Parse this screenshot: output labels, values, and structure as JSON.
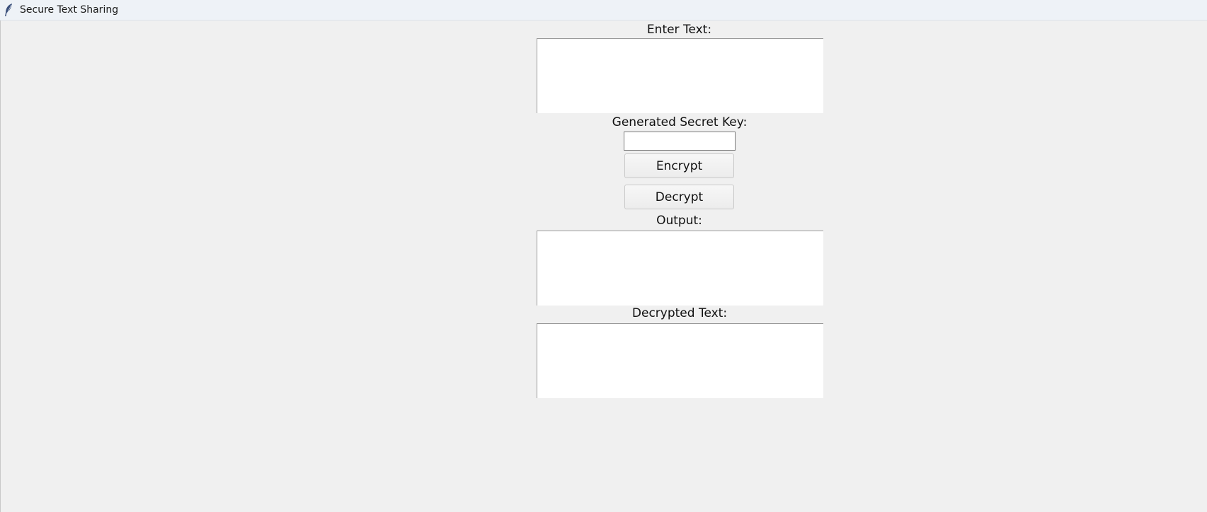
{
  "window": {
    "title": "Secure Text Sharing",
    "icon": "feather-icon"
  },
  "form": {
    "enter_text_label": "Enter Text:",
    "enter_text_value": "",
    "secret_key_label": "Generated Secret Key:",
    "secret_key_value": "",
    "encrypt_label": "Encrypt",
    "decrypt_label": "Decrypt",
    "output_label": "Output:",
    "output_value": "",
    "decrypted_label": "Decrypted Text:",
    "decrypted_value": ""
  },
  "colors": {
    "background": "#f0f0f0",
    "titlebar": "#eef2f7",
    "field": "#ffffff"
  }
}
